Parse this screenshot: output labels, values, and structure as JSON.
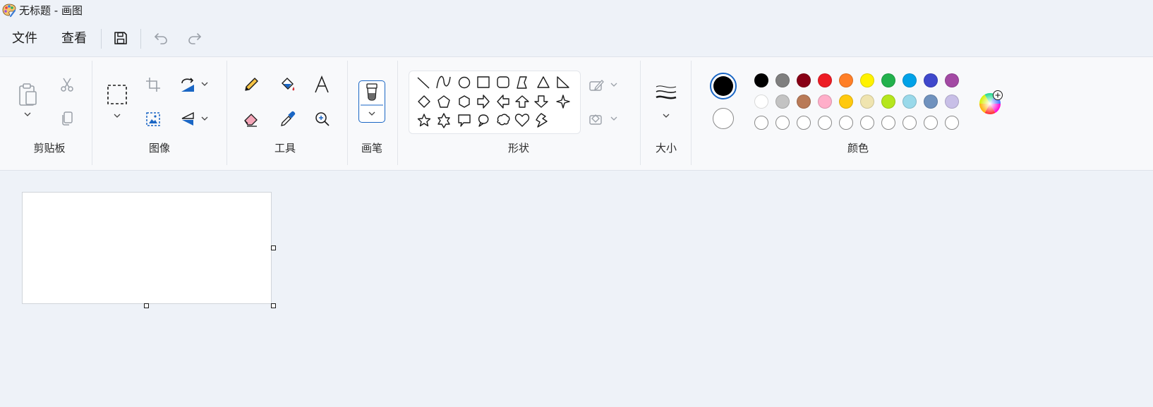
{
  "window": {
    "title": "无标题 - 画图"
  },
  "menu": {
    "file": "文件",
    "view": "查看"
  },
  "groups": {
    "clipboard": "剪贴板",
    "image": "图像",
    "tools": "工具",
    "brushes": "画笔",
    "shapes": "形状",
    "size": "大小",
    "colors": "颜色"
  },
  "colors": {
    "primary": "#000000",
    "secondary": "#ffffff",
    "palette_row1": [
      "#000000",
      "#7f7f7f",
      "#880015",
      "#ed1c24",
      "#ff7f27",
      "#fff200",
      "#22b14c",
      "#00a2e8",
      "#3f48cc",
      "#a349a4"
    ],
    "palette_row2": [
      "#ffffff",
      "#c3c3c3",
      "#b97a57",
      "#ffaec9",
      "#ffc90e",
      "#efe4b0",
      "#b5e61d",
      "#99d9ea",
      "#7092be",
      "#c8bfe7"
    ],
    "palette_row3_empty_count": 10
  }
}
